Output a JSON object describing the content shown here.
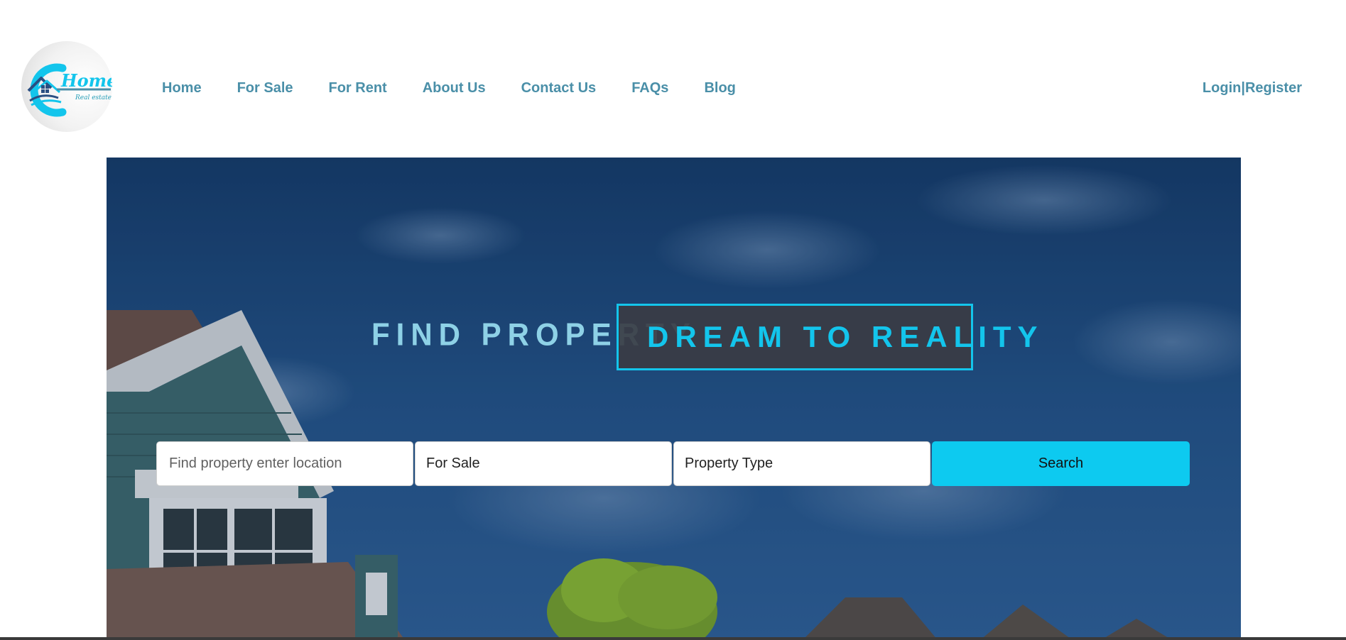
{
  "brand": {
    "logo_word": "Home",
    "logo_tagline": "Real estate",
    "logo_letter": "C"
  },
  "nav": {
    "items": [
      {
        "label": "Home"
      },
      {
        "label": "For Sale"
      },
      {
        "label": "For Rent"
      },
      {
        "label": "About Us"
      },
      {
        "label": "Contact Us"
      },
      {
        "label": "FAQs"
      },
      {
        "label": "Blog"
      }
    ],
    "login": "Login",
    "separator": "|",
    "register": "Register"
  },
  "hero": {
    "title_left": "FIND PROPERTY",
    "title_right": "DREAM TO REALITY"
  },
  "search": {
    "location_placeholder": "Find property enter location",
    "listing_type": "For Sale",
    "property_type": "Property Type",
    "button_label": "Search"
  },
  "colors": {
    "nav_text": "#4a8fa8",
    "accent": "#13c5ec",
    "search_button": "#0dcaf0",
    "title_left": "#8ed1e6"
  },
  "icons": {
    "logo": "house-roof-icon"
  }
}
